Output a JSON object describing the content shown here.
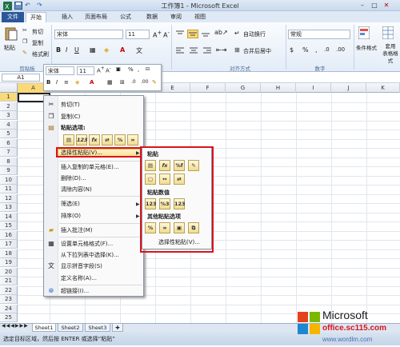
{
  "window": {
    "title": "工作簿1 - Microsoft Excel"
  },
  "tabs": [
    "文件",
    "开始",
    "插入",
    "页面布局",
    "公式",
    "数据",
    "审阅",
    "视图"
  ],
  "ribbon": {
    "clipboard": {
      "paste": "粘贴",
      "cut": "剪切",
      "copy": "复制",
      "format_painter": "格式刷",
      "label": "剪贴板"
    },
    "font": {
      "name": "宋体",
      "size": "11"
    },
    "alignment": {
      "wrap": "自动换行",
      "merge": "合并后居中",
      "label": "对齐方式"
    },
    "number": {
      "format": "常规",
      "label": "数字"
    },
    "styles": {
      "conditional": "条件格式",
      "table": "套用\n表格格式"
    }
  },
  "formula_bar": {
    "namebox": "A1"
  },
  "minitoolbar": {
    "font": "宋体",
    "size": "11"
  },
  "columns": [
    "A",
    "B",
    "C",
    "D",
    "E",
    "F",
    "G",
    "H",
    "I",
    "J",
    "K"
  ],
  "rows": [
    "1",
    "2",
    "3",
    "4",
    "5",
    "6",
    "7",
    "8",
    "9",
    "10",
    "11",
    "12",
    "13",
    "14",
    "15",
    "16",
    "17",
    "18",
    "19",
    "20",
    "21",
    "22",
    "23",
    "24",
    "25"
  ],
  "context_menu": {
    "cut": "剪切(T)",
    "copy": "复制(C)",
    "paste_options": "粘贴选项:",
    "paste_special": "选择性粘贴(V)...",
    "insert_copied": "插入复制的单元格(E)...",
    "delete": "删除(D)...",
    "clear": "清除内容(N)",
    "filter": "筛选(E)",
    "sort": "排序(O)",
    "insert_comment": "插入批注(M)",
    "format_cells": "设置单元格格式(F)...",
    "pick_list": "从下拉列表中选择(K)...",
    "phonetic": "显示拼音字段(S)",
    "define_name": "定义名称(A)...",
    "hyperlink": "超链接(I)..."
  },
  "submenu": {
    "paste_header": "粘贴",
    "values_header": "粘贴数值",
    "other_header": "其他粘贴选项",
    "paste_special": "选择性粘贴(V)..."
  },
  "sheets": [
    "Sheet1",
    "Sheet2",
    "Sheet3"
  ],
  "status": "选定目标区域，然后按 ENTER 或选择“粘贴”",
  "watermark": {
    "brand": "Microsoft",
    "site": "office.sc115.com",
    "site2": "www.wordlm.com"
  }
}
